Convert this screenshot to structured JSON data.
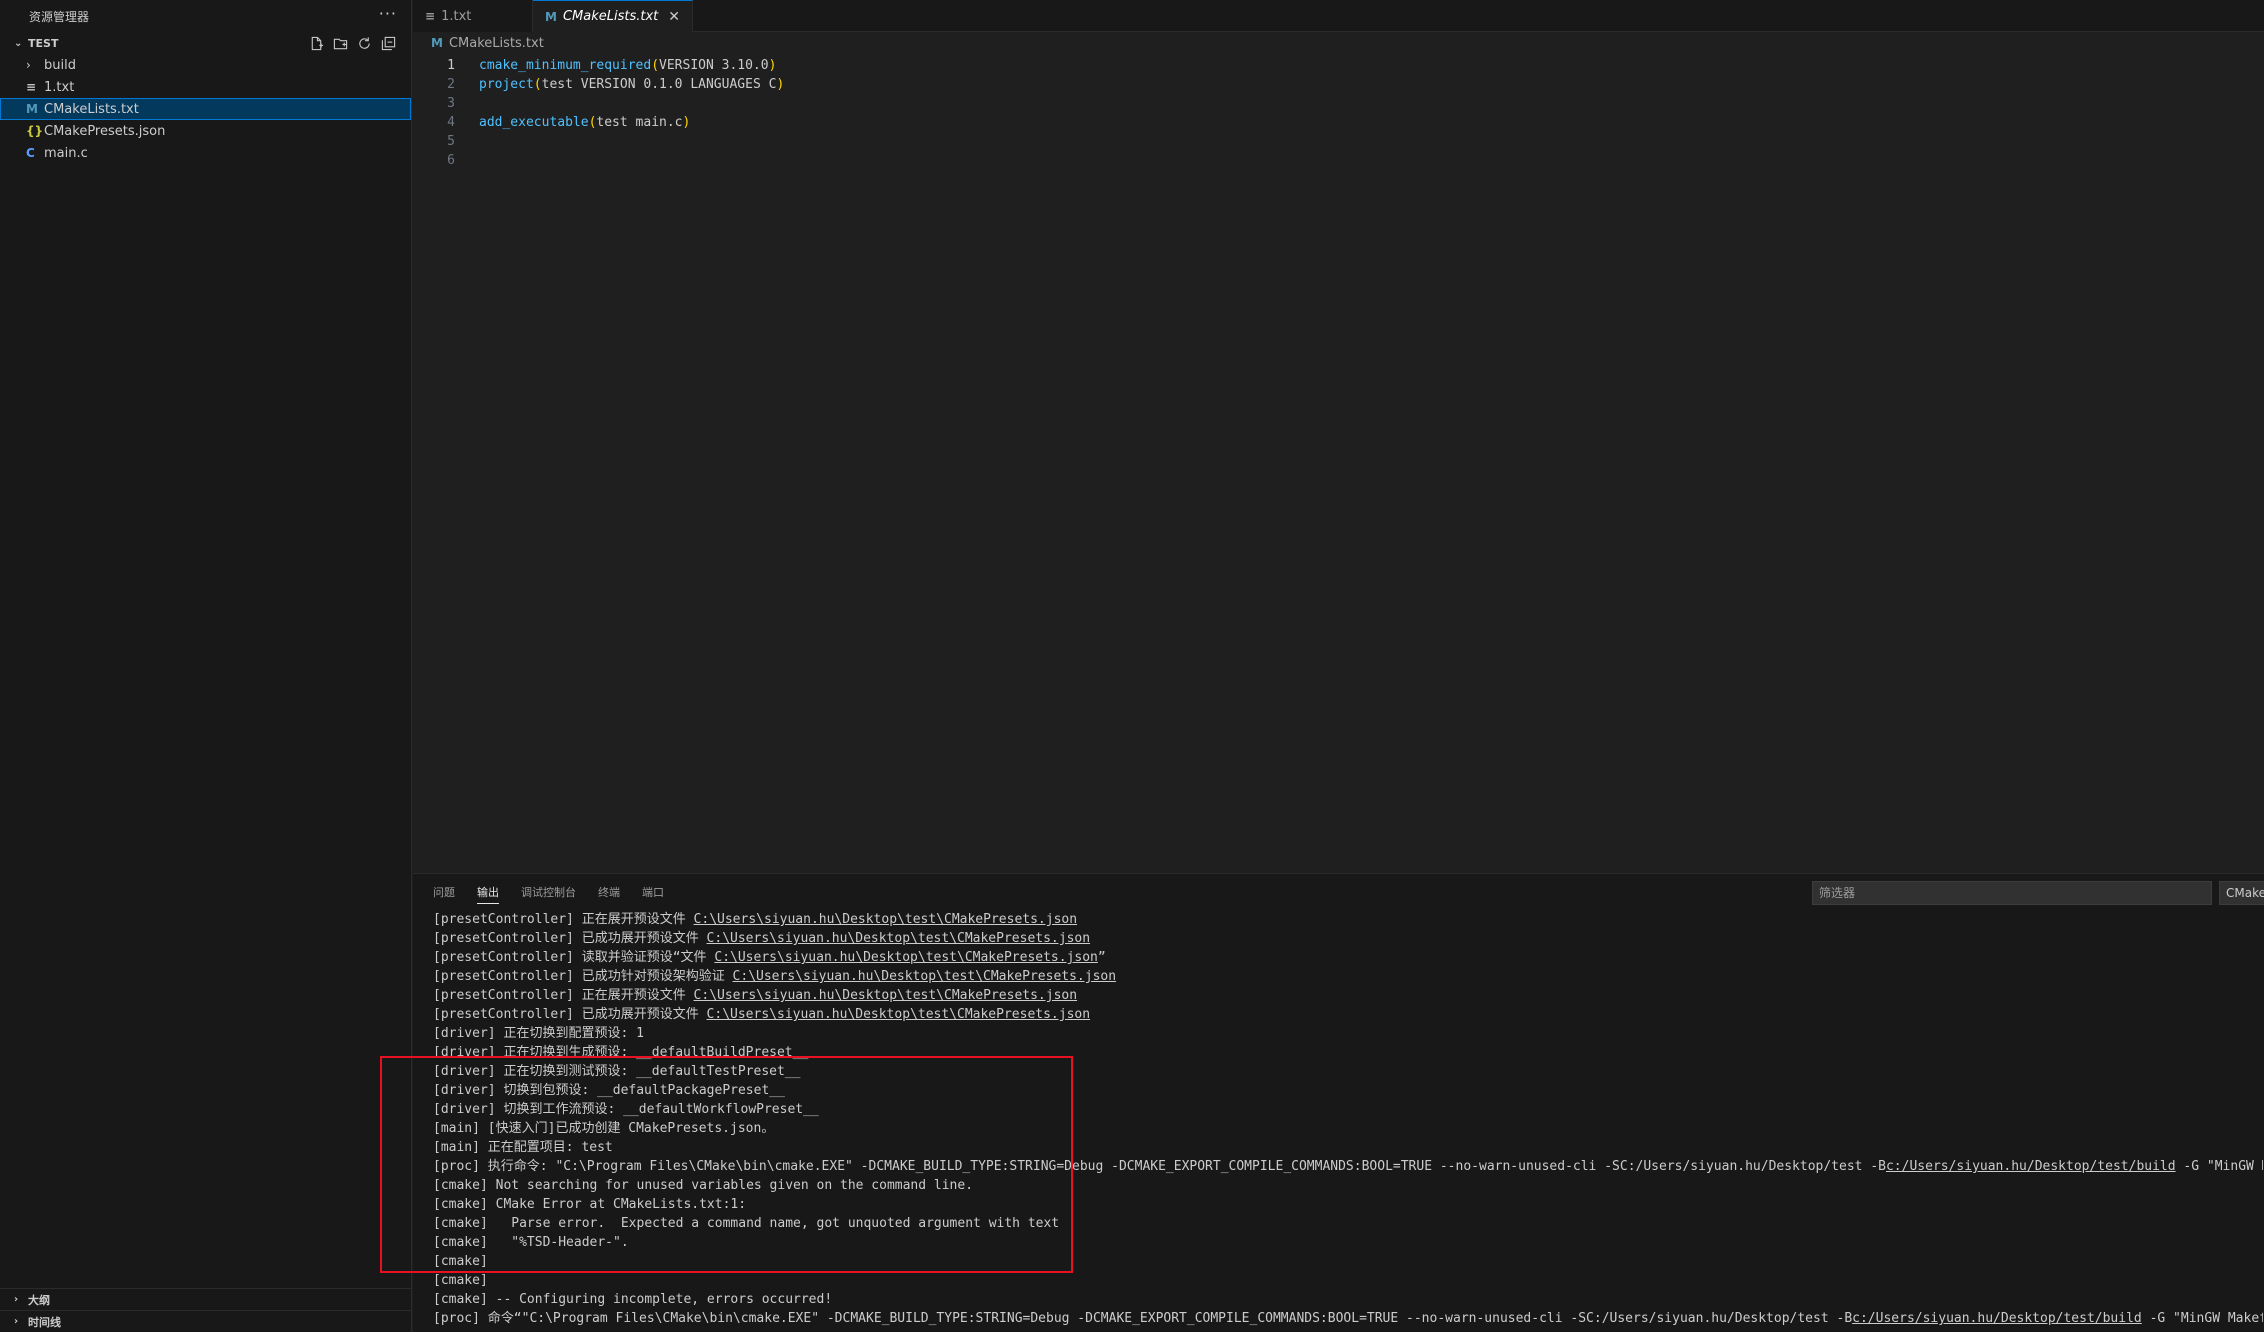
{
  "sidebar": {
    "title": "资源管理器",
    "more": "···",
    "section": "TEST",
    "items": [
      {
        "label": "build",
        "icon": "chevron-right-icon",
        "glyph": "›",
        "kind": "folder"
      },
      {
        "label": "1.txt",
        "icon": "text-file-icon",
        "glyph": "≡",
        "kind": "txt"
      },
      {
        "label": "CMakeLists.txt",
        "icon": "cmake-file-icon",
        "glyph": "M",
        "kind": "cmake",
        "selected": true
      },
      {
        "label": "CMakePresets.json",
        "icon": "json-file-icon",
        "glyph": "{}",
        "kind": "json"
      },
      {
        "label": "main.c",
        "icon": "c-file-icon",
        "glyph": "C",
        "kind": "c"
      }
    ],
    "bottom_sections": [
      "大纲",
      "时间线"
    ]
  },
  "editor": {
    "tabs": [
      {
        "label": "1.txt",
        "glyph": "≡",
        "active": false
      },
      {
        "label": "CMakeLists.txt",
        "glyph": "M",
        "active": true,
        "close": "✕"
      }
    ],
    "breadcrumb": {
      "glyph": "M",
      "label": "CMakeLists.txt"
    },
    "lines": [
      {
        "n": "1",
        "fn": "cmake_minimum_required",
        "args": "VERSION 3.10.0"
      },
      {
        "n": "2",
        "fn": "project",
        "args": "test VERSION 0.1.0 LANGUAGES C"
      },
      {
        "n": "3",
        "fn": "",
        "args": ""
      },
      {
        "n": "4",
        "fn": "add_executable",
        "args": "test main.c"
      },
      {
        "n": "5",
        "fn": "",
        "args": ""
      },
      {
        "n": "6",
        "fn": "",
        "args": ""
      }
    ]
  },
  "panel": {
    "tabs": [
      "问题",
      "输出",
      "调试控制台",
      "终端",
      "端口"
    ],
    "active_tab": "输出",
    "filter_placeholder": "筛选器",
    "channel": "CMake",
    "output": [
      {
        "pre": "[presetController] 正在展开预设文件 ",
        "link": "C:\\Users\\siyuan.hu\\Desktop\\test\\CMakePresets.json",
        "post": ""
      },
      {
        "pre": "[presetController] 已成功展开预设文件 ",
        "link": "C:\\Users\\siyuan.hu\\Desktop\\test\\CMakePresets.json",
        "post": ""
      },
      {
        "pre": "[presetController] 读取并验证预设“文件 ",
        "link": "C:\\Users\\siyuan.hu\\Desktop\\test\\CMakePresets.json",
        "post": "”"
      },
      {
        "pre": "[presetController] 已成功针对预设架构验证 ",
        "link": "C:\\Users\\siyuan.hu\\Desktop\\test\\CMakePresets.json",
        "post": ""
      },
      {
        "pre": "[presetController] 正在展开预设文件 ",
        "link": "C:\\Users\\siyuan.hu\\Desktop\\test\\CMakePresets.json",
        "post": ""
      },
      {
        "pre": "[presetController] 已成功展开预设文件 ",
        "link": "C:\\Users\\siyuan.hu\\Desktop\\test\\CMakePresets.json",
        "post": ""
      },
      {
        "pre": "[driver] 正在切换到配置预设: 1",
        "link": "",
        "post": ""
      },
      {
        "pre": "[driver] 正在切换到生成预设: __defaultBuildPreset__",
        "link": "",
        "post": ""
      },
      {
        "pre": "[driver] 正在切换到测试预设: __defaultTestPreset__",
        "link": "",
        "post": ""
      },
      {
        "pre": "[driver] 切换到包预设: __defaultPackagePreset__",
        "link": "",
        "post": ""
      },
      {
        "pre": "[driver] 切换到工作流预设: __defaultWorkflowPreset__",
        "link": "",
        "post": ""
      },
      {
        "pre": "[main] [快速入门]已成功创建 CMakePresets.json。",
        "link": "",
        "post": ""
      },
      {
        "pre": "[main] 正在配置项目: test",
        "link": "",
        "post": ""
      },
      {
        "pre": "[proc] 执行命令: \"C:\\Program Files\\CMake\\bin\\cmake.EXE\" -DCMAKE_BUILD_TYPE:STRING=Debug -DCMAKE_EXPORT_COMPILE_COMMANDS:BOOL=TRUE --no-warn-unused-cli -SC:/Users/siyuan.hu/Desktop/test -B",
        "link": "c:/Users/siyuan.hu/Desktop/test/build",
        "post": " -G \"MinGW Makefiles\""
      },
      {
        "pre": "[cmake] Not searching for unused variables given on the command line.",
        "link": "",
        "post": ""
      },
      {
        "pre": "[cmake] CMake Error at CMakeLists.txt:1:",
        "link": "",
        "post": ""
      },
      {
        "pre": "[cmake]   Parse error.  Expected a command name, got unquoted argument with text",
        "link": "",
        "post": ""
      },
      {
        "pre": "[cmake]   \"%TSD-Header-\".",
        "link": "",
        "post": ""
      },
      {
        "pre": "[cmake] ",
        "link": "",
        "post": ""
      },
      {
        "pre": "[cmake] ",
        "link": "",
        "post": ""
      },
      {
        "pre": "[cmake] -- Configuring incomplete, errors occurred!",
        "link": "",
        "post": ""
      },
      {
        "pre": "[proc] 命令“\"C:\\Program Files\\CMake\\bin\\cmake.EXE\" -DCMAKE_BUILD_TYPE:STRING=Debug -DCMAKE_EXPORT_COMPILE_COMMANDS:BOOL=TRUE --no-warn-unused-cli -SC:/Users/siyuan.hu/Desktop/test -B",
        "link": "c:/Users/siyuan.hu/Desktop/test/build",
        "post": " -G \"MinGW Makefiles\"”"
      }
    ]
  }
}
